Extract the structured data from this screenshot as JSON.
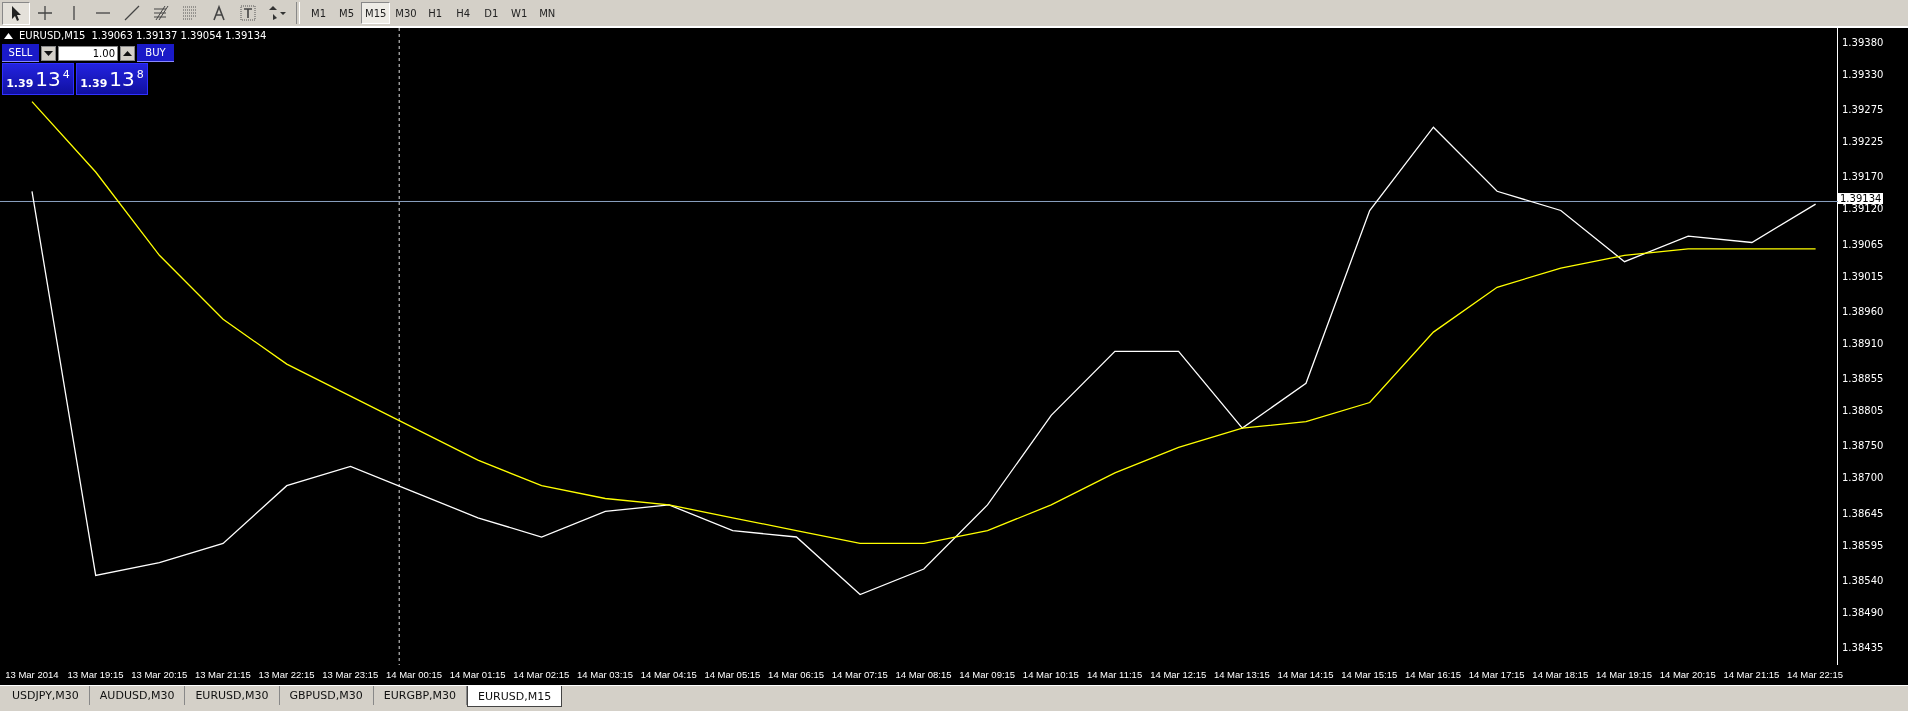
{
  "toolbar": {
    "tools": [
      {
        "kind": "cursor",
        "selected": true
      },
      {
        "kind": "crosshair",
        "selected": false
      },
      {
        "kind": "vline",
        "selected": false
      },
      {
        "kind": "hline",
        "selected": false
      },
      {
        "kind": "trend",
        "selected": false
      },
      {
        "kind": "fibe",
        "selected": false
      },
      {
        "kind": "fibf",
        "selected": false
      },
      {
        "kind": "text",
        "selected": false
      },
      {
        "kind": "label",
        "selected": false
      },
      {
        "kind": "arrows",
        "selected": false
      }
    ],
    "timeframes": [
      {
        "label": "M1",
        "selected": false
      },
      {
        "label": "M5",
        "selected": false
      },
      {
        "label": "M15",
        "selected": true
      },
      {
        "label": "M30",
        "selected": false
      },
      {
        "label": "H1",
        "selected": false
      },
      {
        "label": "H4",
        "selected": false
      },
      {
        "label": "D1",
        "selected": false
      },
      {
        "label": "W1",
        "selected": false
      },
      {
        "label": "MN",
        "selected": false
      }
    ]
  },
  "chart": {
    "symbol": "EURUSD,M15",
    "ohlc": "1.39063 1.39137 1.39054 1.39134",
    "current_price": "1.39134",
    "trade_panel": {
      "sell_label": "SELL",
      "buy_label": "BUY",
      "lot": "1.00",
      "sell_price": {
        "prefix": "1.39",
        "big": "13",
        "small": "4"
      },
      "buy_price": {
        "prefix": "1.39",
        "big": "13",
        "small": "8"
      }
    },
    "chart_data": {
      "type": "line",
      "categories": [
        "13 Mar 2014",
        "13 Mar 19:15",
        "13 Mar 20:15",
        "13 Mar 21:15",
        "13 Mar 22:15",
        "13 Mar 23:15",
        "14 Mar 00:15",
        "14 Mar 01:15",
        "14 Mar 02:15",
        "14 Mar 03:15",
        "14 Mar 04:15",
        "14 Mar 05:15",
        "14 Mar 06:15",
        "14 Mar 07:15",
        "14 Mar 08:15",
        "14 Mar 09:15",
        "14 Mar 10:15",
        "14 Mar 11:15",
        "14 Mar 12:15",
        "14 Mar 13:15",
        "14 Mar 14:15",
        "14 Mar 15:15",
        "14 Mar 16:15",
        "14 Mar 17:15",
        "14 Mar 18:15",
        "14 Mar 19:15",
        "14 Mar 20:15",
        "14 Mar 21:15",
        "14 Mar 22:15"
      ],
      "series": [
        {
          "color": "#ffffff",
          "values": [
            1.3915,
            1.3855,
            1.3857,
            1.386,
            1.3869,
            1.3872,
            1.3868,
            1.3864,
            1.3861,
            1.3865,
            1.3866,
            1.3862,
            1.3861,
            1.3852,
            1.3856,
            1.3866,
            1.388,
            1.389,
            1.389,
            1.3878,
            1.3885,
            1.3912,
            1.3925,
            1.3915,
            1.3912,
            1.3904,
            1.3908,
            1.3907,
            1.3913
          ]
        },
        {
          "color": "#ffff00",
          "values": [
            1.3929,
            1.3918,
            1.3905,
            1.3895,
            1.3888,
            1.3883,
            1.3878,
            1.3873,
            1.3869,
            1.3867,
            1.3866,
            1.3864,
            1.3862,
            1.386,
            1.386,
            1.3862,
            1.3866,
            1.3871,
            1.3875,
            1.3878,
            1.3879,
            1.3882,
            1.3893,
            1.39,
            1.3903,
            1.3905,
            1.3906,
            1.3906,
            1.3906
          ]
        }
      ],
      "ylim": [
        1.3841,
        1.39405
      ],
      "ref_lines": [
        {
          "axis": "x",
          "value": "14 Mar 00:15",
          "color": "#dddddd"
        },
        {
          "axis": "y",
          "value": 1.39134,
          "color": "#8aa0c0"
        }
      ],
      "yticks": [
        {
          "value": 1.3938,
          "label": "1.39380"
        },
        {
          "value": 1.3933,
          "label": "1.39330"
        },
        {
          "value": 1.39275,
          "label": "1.39275"
        },
        {
          "value": 1.39225,
          "label": "1.39225"
        },
        {
          "value": 1.3917,
          "label": "1.39170"
        },
        {
          "value": 1.3912,
          "label": "1.39120"
        },
        {
          "value": 1.39065,
          "label": "1.39065"
        },
        {
          "value": 1.39015,
          "label": "1.39015"
        },
        {
          "value": 1.3896,
          "label": "1.38960"
        },
        {
          "value": 1.3891,
          "label": "1.38910"
        },
        {
          "value": 1.38855,
          "label": "1.38855"
        },
        {
          "value": 1.38805,
          "label": "1.38805"
        },
        {
          "value": 1.3875,
          "label": "1.38750"
        },
        {
          "value": 1.387,
          "label": "1.38700"
        },
        {
          "value": 1.38645,
          "label": "1.38645"
        },
        {
          "value": 1.38595,
          "label": "1.38595"
        },
        {
          "value": 1.3854,
          "label": "1.38540"
        },
        {
          "value": 1.3849,
          "label": "1.38490"
        },
        {
          "value": 1.38435,
          "label": "1.38435"
        }
      ]
    }
  },
  "tabs": [
    {
      "label": "USDJPY,M30",
      "selected": false
    },
    {
      "label": "AUDUSD,M30",
      "selected": false
    },
    {
      "label": "EURUSD,M30",
      "selected": false
    },
    {
      "label": "GBPUSD,M30",
      "selected": false
    },
    {
      "label": "EURGBP,M30",
      "selected": false
    },
    {
      "label": "EURUSD,M15",
      "selected": true
    }
  ]
}
